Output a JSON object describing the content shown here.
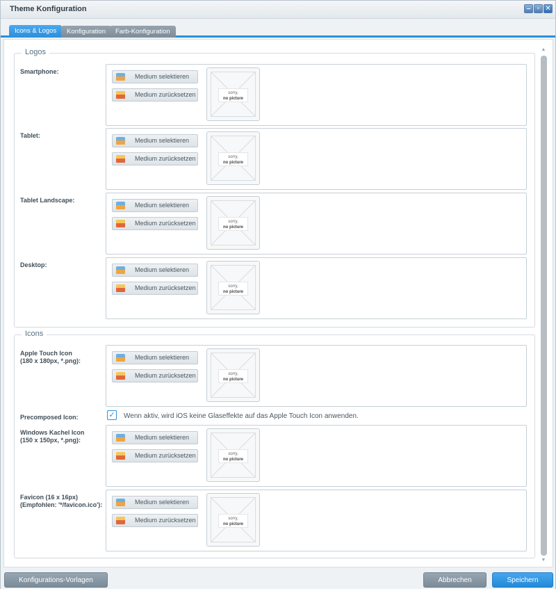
{
  "window": {
    "title": "Theme Konfiguration"
  },
  "window_controls": {
    "minimize": "–",
    "maximize": "▫",
    "close": "✕"
  },
  "tabs": [
    "Icons & Logos",
    "Konfiguration",
    "Farb-Konfiguration"
  ],
  "media_buttons": {
    "select": "Medium selektieren",
    "reset": "Medium zurücksetzen"
  },
  "no_picture": {
    "line1": "sorry,",
    "line2": "no picture"
  },
  "logos": {
    "legend": "Logos",
    "rows": [
      "Smartphone:",
      "Tablet:",
      "Tablet Landscape:",
      "Desktop:"
    ]
  },
  "icons": {
    "legend": "Icons",
    "apple": {
      "label1": "Apple Touch Icon",
      "label2": "(180 x 180px, *.png):"
    },
    "precomposed": {
      "label": "Precomposed Icon:",
      "checked": true,
      "text": "Wenn aktiv, wird iOS keine Glaseffekte auf das Apple Touch Icon anwenden."
    },
    "windows": {
      "label1": "Windows Kachel Icon",
      "label2": "(150 x 150px, *.png):"
    },
    "favicon": {
      "label1": "Favicon (16 x 16px)",
      "label2": "(Empfohlen: '*/favicon.ico'):"
    }
  },
  "footer": {
    "templates": "Konfigurations-Vorlagen",
    "cancel": "Abbrechen",
    "save": "Speichern"
  },
  "icon_names": {
    "select": "image-select-icon",
    "reset": "image-reset-icon",
    "check": "checkmark-icon"
  },
  "colors": {
    "accent": "#2a8fdc",
    "grey_button": "#8796a2"
  }
}
